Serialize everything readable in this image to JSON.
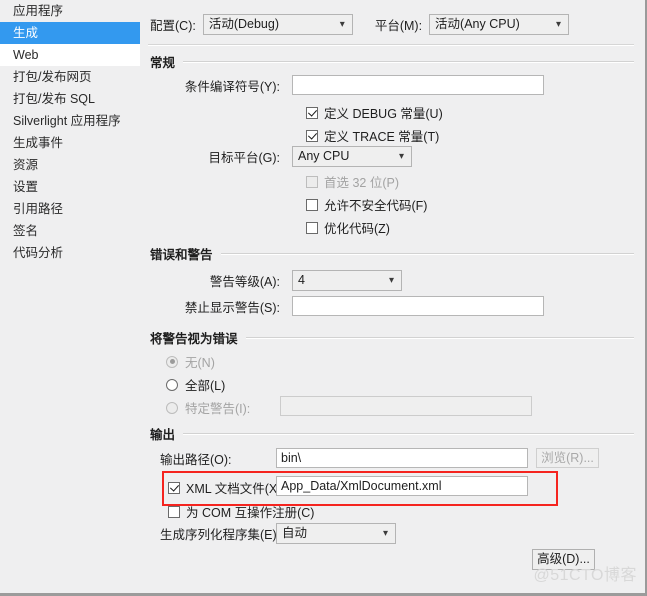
{
  "sidebar": {
    "items": [
      {
        "label": "应用程序",
        "state": "normal"
      },
      {
        "label": "生成",
        "state": "selected"
      },
      {
        "label": "Web",
        "state": "hover"
      },
      {
        "label": "打包/发布网页",
        "state": "normal"
      },
      {
        "label": "打包/发布 SQL",
        "state": "normal"
      },
      {
        "label": "Silverlight 应用程序",
        "state": "normal"
      },
      {
        "label": "生成事件",
        "state": "normal"
      },
      {
        "label": "资源",
        "state": "normal"
      },
      {
        "label": "设置",
        "state": "normal"
      },
      {
        "label": "引用路径",
        "state": "normal"
      },
      {
        "label": "签名",
        "state": "normal"
      },
      {
        "label": "代码分析",
        "state": "normal"
      }
    ]
  },
  "config_bar": {
    "configuration_label": "配置(C):",
    "configuration_value": "活动(Debug)",
    "platform_label": "平台(M):",
    "platform_value": "活动(Any CPU)"
  },
  "general": {
    "group_title": "常规",
    "conditional_symbols_label": "条件编译符号(Y):",
    "conditional_symbols_value": "",
    "define_debug_label": "定义 DEBUG 常量(U)",
    "define_debug_checked": true,
    "define_trace_label": "定义 TRACE 常量(T)",
    "define_trace_checked": true,
    "target_platform_label": "目标平台(G):",
    "target_platform_value": "Any CPU",
    "prefer32_label": "首选 32 位(P)",
    "prefer32_checked": false,
    "prefer32_disabled": true,
    "allow_unsafe_label": "允许不安全代码(F)",
    "allow_unsafe_checked": false,
    "optimize_label": "优化代码(Z)",
    "optimize_checked": false
  },
  "errors_warnings": {
    "group_title": "错误和警告",
    "warning_level_label": "警告等级(A):",
    "warning_level_value": "4",
    "suppress_warnings_label": "禁止显示警告(S):",
    "suppress_warnings_value": ""
  },
  "treat_warnings": {
    "group_title": "将警告视为错误",
    "none_label": "无(N)",
    "none_selected": true,
    "none_disabled": true,
    "all_label": "全部(L)",
    "all_selected": false,
    "specific_label": "特定警告(I):",
    "specific_selected": false,
    "specific_disabled": true,
    "specific_value": ""
  },
  "output": {
    "group_title": "输出",
    "output_path_label": "输出路径(O):",
    "output_path_value": "bin\\",
    "browse_label": "浏览(R)...",
    "xml_doc_label": "XML 文档文件(X):",
    "xml_doc_checked": true,
    "xml_doc_value": "App_Data/XmlDocument.xml",
    "register_com_label": "为 COM 互操作注册(C)",
    "register_com_checked": false,
    "serialization_label": "生成序列化程序集(E):",
    "serialization_value": "自动",
    "advanced_label": "高级(D)..."
  },
  "watermark": {
    "text": "@51CTO博客"
  },
  "icons": {
    "chevron_down": "chevron-down-icon"
  },
  "colors": {
    "accent": "#3399ef",
    "highlight_box": "#f5241f",
    "panel_bg": "#efeff0"
  }
}
